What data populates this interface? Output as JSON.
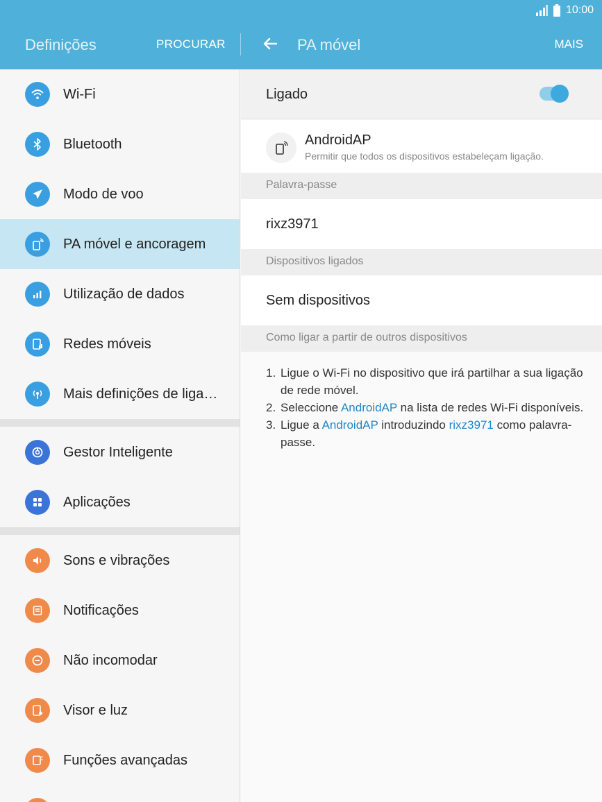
{
  "status": {
    "time": "10:00",
    "colors": {
      "bar": "#4fb0d9"
    }
  },
  "appbar": {
    "left_title": "Definições",
    "search_label": "PROCURAR",
    "right_title": "PA móvel",
    "more_label": "MAIS"
  },
  "sidebar": {
    "items": [
      {
        "label": "Wi-Fi",
        "icon": "wifi-icon"
      },
      {
        "label": "Bluetooth",
        "icon": "bluetooth-icon"
      },
      {
        "label": "Modo de voo",
        "icon": "airplane-icon"
      },
      {
        "label": "PA móvel e ancoragem",
        "icon": "hotspot-icon"
      },
      {
        "label": "Utilização de dados",
        "icon": "data-usage-icon"
      },
      {
        "label": "Redes móveis",
        "icon": "mobile-network-icon"
      },
      {
        "label": "Mais definições de liga…",
        "icon": "more-connections-icon"
      },
      {
        "label": "Gestor Inteligente",
        "icon": "smart-manager-icon"
      },
      {
        "label": "Aplicações",
        "icon": "apps-icon"
      },
      {
        "label": "Sons e vibrações",
        "icon": "sound-icon"
      },
      {
        "label": "Notificações",
        "icon": "notifications-icon"
      },
      {
        "label": "Não incomodar",
        "icon": "do-not-disturb-icon"
      },
      {
        "label": "Visor e luz",
        "icon": "display-icon"
      },
      {
        "label": "Funções avançadas",
        "icon": "advanced-features-icon"
      }
    ],
    "active_index": 3
  },
  "hotspot": {
    "toggle_label": "Ligado",
    "toggle_on": true,
    "network_name": "AndroidAP",
    "network_sub": "Permitir que todos os dispositivos estabeleçam ligação.",
    "password_header": "Palavra-passe",
    "password": "rixz3971",
    "devices_header": "Dispositivos ligados",
    "devices_value": "Sem dispositivos",
    "howto_header": "Como ligar a partir de outros dispositivos",
    "steps": {
      "n1": "1.",
      "s1": "Ligue o Wi-Fi no dispositivo que irá partilhar a sua ligação de rede móvel.",
      "n2": "2.",
      "s2a": "Seleccione ",
      "s2b": " na lista de redes Wi-Fi disponíveis.",
      "n3": "3.",
      "s3a": "Ligue a ",
      "s3b": " introduzindo ",
      "s3c": " como palavra-passe."
    }
  }
}
